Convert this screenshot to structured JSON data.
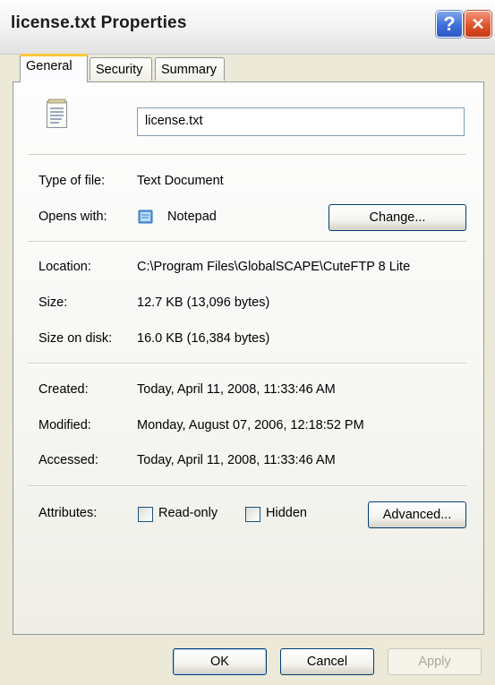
{
  "window": {
    "title": "license.txt Properties"
  },
  "titlebar_buttons": {
    "help": "?",
    "close": "✕"
  },
  "tabs": [
    {
      "label": "General"
    },
    {
      "label": "Security"
    },
    {
      "label": "Summary"
    }
  ],
  "general": {
    "filename": "license.txt",
    "type_label": "Type of file:",
    "type_value": "Text Document",
    "opens_label": "Opens with:",
    "opens_value": "Notepad",
    "change_button": "Change...",
    "location_label": "Location:",
    "location_value": "C:\\Program Files\\GlobalSCAPE\\CuteFTP 8 Lite",
    "size_label": "Size:",
    "size_value": "12.7 KB (13,096 bytes)",
    "size_on_disk_label": "Size on disk:",
    "size_on_disk_value": "16.0 KB (16,384 bytes)",
    "created_label": "Created:",
    "created_value": "Today, April 11, 2008, 11:33:46 AM",
    "modified_label": "Modified:",
    "modified_value": "Monday, August 07, 2006, 12:18:52 PM",
    "accessed_label": "Accessed:",
    "accessed_value": "Today, April 11, 2008, 11:33:46 AM",
    "attributes_label": "Attributes:",
    "readonly_label": "Read-only",
    "readonly_checked": false,
    "hidden_label": "Hidden",
    "hidden_checked": false,
    "advanced_button": "Advanced..."
  },
  "footer": {
    "ok": "OK",
    "cancel": "Cancel",
    "apply": "Apply"
  },
  "colors": {
    "accent_tab": "#ffc83c",
    "close": "#e0532c",
    "help": "#3f6fd8",
    "dialog_bg": "#ece9d8"
  },
  "icons": {
    "file": "text-file-icon",
    "notepad": "notepad-icon"
  }
}
